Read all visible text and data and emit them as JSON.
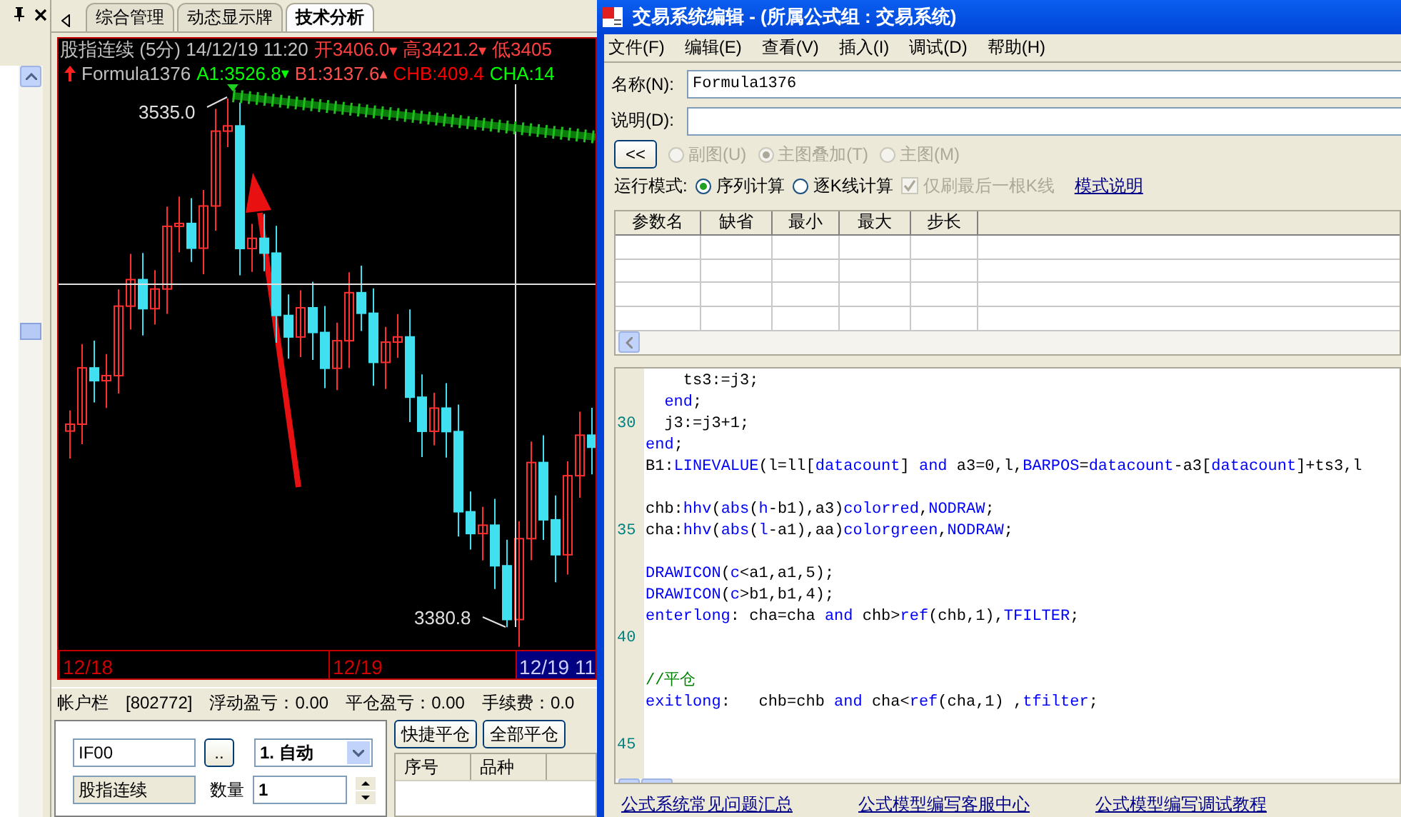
{
  "tabs": [
    {
      "label": "综合管理",
      "selected": false
    },
    {
      "label": "动态显示牌",
      "selected": false
    },
    {
      "label": "技术分析",
      "selected": true
    }
  ],
  "chart": {
    "title": "股指连续 (5分) 14/12/19 11:20",
    "quotes": [
      {
        "text": "开3406.0",
        "color": "#ff4040",
        "marker": "▾"
      },
      {
        "text": "高3421.2",
        "color": "#ff4040",
        "marker": "▾"
      },
      {
        "text": "低3405",
        "color": "#ff4040"
      }
    ],
    "formula": "Formula1376",
    "values": [
      {
        "text": "A1:3526.8",
        "color": "#00ff00",
        "marker": "▾"
      },
      {
        "text": "B1:3137.6",
        "color": "#ff5050",
        "marker": "▴"
      },
      {
        "text": "CHB:409.4",
        "color": "#ff0000"
      },
      {
        "text": "CHA:14",
        "color": "#00ff00"
      }
    ],
    "price_labels": [
      "3535.0",
      "3380.8"
    ],
    "dates": [
      {
        "label": "12/18",
        "selected": false
      },
      {
        "label": "12/19",
        "selected": false
      },
      {
        "label": "12/19 11",
        "selected": true
      }
    ]
  },
  "account_bar": [
    "帐户栏",
    "[802772]",
    "浮动盈亏：0.00",
    "平仓盈亏：0.00",
    "手续费：0.0"
  ],
  "order": {
    "symbol": "IF00",
    "browse_button": "..",
    "mode": "1. 自动",
    "contract": "股指连续",
    "quantity_label": "数量",
    "quantity": "1",
    "buttons": [
      "快捷平仓",
      "全部平仓"
    ],
    "columns": [
      "序号",
      "品种"
    ]
  },
  "editor": {
    "title": "交易系统编辑 - (所属公式组 : 交易系统)",
    "menu": [
      "文件(F)",
      "编辑(E)",
      "查看(V)",
      "插入(I)",
      "调试(D)",
      "帮助(H)"
    ],
    "name_label": "名称(N):",
    "name": "Formula1376",
    "desc_label": "说明(D):",
    "collapse_button": "<<",
    "chart_types": [
      {
        "label": "副图(U)",
        "selected": false,
        "disabled": true
      },
      {
        "label": "主图叠加(T)",
        "selected": true,
        "disabled": true
      },
      {
        "label": "主图(M)",
        "selected": false,
        "disabled": true
      }
    ],
    "run_mode_label": "运行模式:",
    "run_modes": [
      {
        "label": "序列计算",
        "selected": true
      },
      {
        "label": "逐K线计算",
        "selected": false
      }
    ],
    "refresh_last": {
      "label": "仅刷最后一根K线",
      "checked": true,
      "disabled": true
    },
    "mode_help_link": "模式说明",
    "param_columns": [
      "参数名",
      "缺省",
      "最小",
      "最大",
      "步长"
    ]
  },
  "code": {
    "lines": [
      {
        "kind": "code",
        "tokens": [
          {
            "text": "    ts3:=j3;",
            "kind": "plain"
          }
        ]
      },
      {
        "kind": "code",
        "tokens": [
          {
            "text": "  end",
            "kind": "keyword"
          },
          {
            "text": ";",
            "kind": "plain"
          }
        ]
      },
      {
        "kind": "code",
        "number": "30",
        "tokens": [
          {
            "text": "  j3:=j3+1;",
            "kind": "plain"
          }
        ]
      },
      {
        "kind": "code",
        "tokens": [
          {
            "text": "end",
            "kind": "keyword"
          },
          {
            "text": ";",
            "kind": "plain"
          }
        ]
      },
      {
        "kind": "code",
        "tokens": [
          {
            "text": "B1:",
            "kind": "plain"
          },
          {
            "text": "LINEVALUE",
            "kind": "keyword"
          },
          {
            "text": "(l=ll[",
            "kind": "plain"
          },
          {
            "text": "datacount",
            "kind": "keyword"
          },
          {
            "text": "] ",
            "kind": "plain"
          },
          {
            "text": "and",
            "kind": "keyword"
          },
          {
            "text": " a3=0,l,",
            "kind": "plain"
          },
          {
            "text": "BARPOS",
            "kind": "keyword"
          },
          {
            "text": "=",
            "kind": "plain"
          },
          {
            "text": "datacount",
            "kind": "keyword"
          },
          {
            "text": "-a3[",
            "kind": "plain"
          },
          {
            "text": "datacount",
            "kind": "keyword"
          },
          {
            "text": "]+ts3,l",
            "kind": "plain"
          }
        ]
      },
      {
        "kind": "blank"
      },
      {
        "kind": "code",
        "tokens": [
          {
            "text": "chb:",
            "kind": "plain"
          },
          {
            "text": "hhv",
            "kind": "keyword"
          },
          {
            "text": "(",
            "kind": "plain"
          },
          {
            "text": "abs",
            "kind": "keyword"
          },
          {
            "text": "(",
            "kind": "plain"
          },
          {
            "text": "h",
            "kind": "keyword"
          },
          {
            "text": "-b1),a3)",
            "kind": "plain"
          },
          {
            "text": "colorred",
            "kind": "keyword"
          },
          {
            "text": ",",
            "kind": "plain"
          },
          {
            "text": "NODRAW",
            "kind": "keyword"
          },
          {
            "text": ";",
            "kind": "plain"
          }
        ]
      },
      {
        "kind": "code",
        "number": "35",
        "tokens": [
          {
            "text": "cha:",
            "kind": "plain"
          },
          {
            "text": "hhv",
            "kind": "keyword"
          },
          {
            "text": "(",
            "kind": "plain"
          },
          {
            "text": "abs",
            "kind": "keyword"
          },
          {
            "text": "(",
            "kind": "plain"
          },
          {
            "text": "l",
            "kind": "keyword"
          },
          {
            "text": "-a1),aa)",
            "kind": "plain"
          },
          {
            "text": "colorgreen",
            "kind": "keyword"
          },
          {
            "text": ",",
            "kind": "plain"
          },
          {
            "text": "NODRAW",
            "kind": "keyword"
          },
          {
            "text": ";",
            "kind": "plain"
          }
        ]
      },
      {
        "kind": "blank"
      },
      {
        "kind": "code",
        "tokens": [
          {
            "text": "DRAWICON",
            "kind": "keyword"
          },
          {
            "text": "(",
            "kind": "plain"
          },
          {
            "text": "c",
            "kind": "keyword"
          },
          {
            "text": "<a1,a1,5);",
            "kind": "plain"
          }
        ]
      },
      {
        "kind": "code",
        "tokens": [
          {
            "text": "DRAWICON",
            "kind": "keyword"
          },
          {
            "text": "(",
            "kind": "plain"
          },
          {
            "text": "c",
            "kind": "keyword"
          },
          {
            "text": ">b1,b1,4);",
            "kind": "plain"
          }
        ]
      },
      {
        "kind": "code",
        "tokens": [
          {
            "text": "enterlong",
            "kind": "keyword"
          },
          {
            "text": ": cha=cha ",
            "kind": "plain"
          },
          {
            "text": "and",
            "kind": "keyword"
          },
          {
            "text": " chb>",
            "kind": "plain"
          },
          {
            "text": "ref",
            "kind": "keyword"
          },
          {
            "text": "(chb,1),",
            "kind": "plain"
          },
          {
            "text": "TFILTER",
            "kind": "keyword"
          },
          {
            "text": ";",
            "kind": "plain"
          }
        ]
      },
      {
        "kind": "blank",
        "number": "40"
      },
      {
        "kind": "blank"
      },
      {
        "kind": "code",
        "tokens": [
          {
            "text": "//平仓",
            "kind": "comment"
          }
        ]
      },
      {
        "kind": "code",
        "tokens": [
          {
            "text": "exitlong",
            "kind": "keyword"
          },
          {
            "text": ":   chb=chb ",
            "kind": "plain"
          },
          {
            "text": "and",
            "kind": "keyword"
          },
          {
            "text": " cha<",
            "kind": "plain"
          },
          {
            "text": "ref",
            "kind": "keyword"
          },
          {
            "text": "(cha,1) ,",
            "kind": "plain"
          },
          {
            "text": "tfilter",
            "kind": "keyword"
          },
          {
            "text": ";",
            "kind": "plain"
          }
        ]
      },
      {
        "kind": "blank"
      },
      {
        "kind": "blank",
        "number": "45"
      },
      {
        "kind": "blank"
      }
    ]
  },
  "links": [
    "公式系统常见问题汇总",
    "公式模型编写客服中心",
    "公式模型编写调试教程"
  ]
}
